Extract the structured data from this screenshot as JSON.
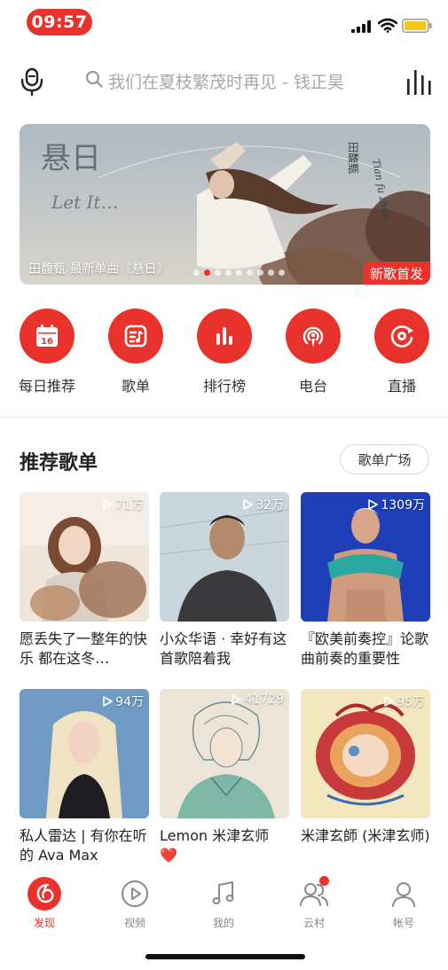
{
  "status_bar": {
    "time": "09:57"
  },
  "header": {
    "search_placeholder": "我们在夏枝繁茂时再见 - 钱正昊"
  },
  "banner": {
    "caption": "田馥甄 最新单曲《悬日》",
    "badge": "新歌首发",
    "art_text": {
      "vertical": "悬日",
      "letters": "Let It…",
      "right": "Tian fu zhen",
      "right_cn": "田馥甄"
    }
  },
  "quick_nav": [
    {
      "label": "每日推荐",
      "icon": "calendar-icon",
      "date": "16"
    },
    {
      "label": "歌单",
      "icon": "playlist-icon"
    },
    {
      "label": "排行榜",
      "icon": "chart-bars-icon"
    },
    {
      "label": "电台",
      "icon": "radio-icon"
    },
    {
      "label": "直播",
      "icon": "live-icon"
    }
  ],
  "section": {
    "title": "推荐歌单",
    "more_label": "歌单广场"
  },
  "playlists": [
    {
      "title": "愿丢失了一整年的快乐 都在这冬…",
      "plays": "71万"
    },
    {
      "title": "小众华语 · 幸好有这首歌陪着我",
      "plays": "32万"
    },
    {
      "title": "『欧美前奏控』论歌曲前奏的重要性",
      "plays": "1309万"
    },
    {
      "title": "私人雷达 | 有你在听的 Ava Max",
      "plays": "94万"
    },
    {
      "title": "Lemon 米津玄师 ❤️",
      "plays": "41729"
    },
    {
      "title": "米津玄師 (米津玄师)",
      "plays": "95万"
    }
  ],
  "tabs": [
    {
      "label": "发现",
      "icon": "discover-icon",
      "active": true
    },
    {
      "label": "视频",
      "icon": "video-icon"
    },
    {
      "label": "我的",
      "icon": "music-note-icon"
    },
    {
      "label": "云村",
      "icon": "friends-icon",
      "badge": true
    },
    {
      "label": "帐号",
      "icon": "account-icon"
    }
  ],
  "colors": {
    "accent": "#e8322b",
    "text": "#222222",
    "muted": "#a8a8a8"
  }
}
